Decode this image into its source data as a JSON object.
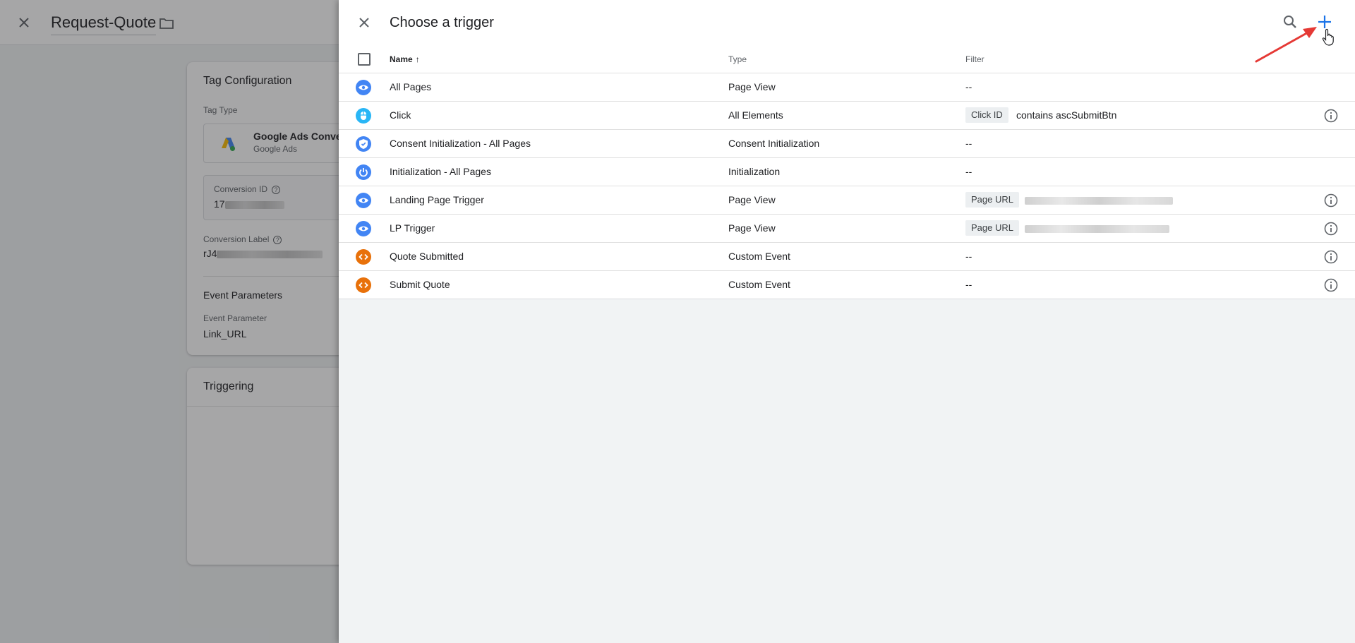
{
  "background": {
    "title": "Request-Quote",
    "tag_config": {
      "heading": "Tag Configuration",
      "tag_type_label": "Tag Type",
      "tag_type_name": "Google Ads Conver",
      "tag_type_sub": "Google Ads",
      "conversion_id_label": "Conversion ID",
      "conversion_id_prefix": "17",
      "conversion_label_label": "Conversion Label",
      "conversion_label_prefix": "rJ4",
      "event_params_heading": "Event Parameters",
      "event_param_label": "Event Parameter",
      "event_param_value": "Link_URL"
    },
    "triggering": {
      "heading": "Triggering"
    }
  },
  "drawer": {
    "title": "Choose a trigger",
    "columns": {
      "name": "Name",
      "sort_arrow": "↑",
      "type": "Type",
      "filter": "Filter"
    },
    "rows": [
      {
        "name": "All Pages",
        "type": "Page View",
        "icon": "eye-icon",
        "color": "#4285f4",
        "filter_text": "--"
      },
      {
        "name": "Click",
        "type": "All Elements",
        "icon": "mouse-icon",
        "color": "#29b6f6",
        "filter_chip": "Click ID",
        "filter_text": "contains ascSubmitBtn",
        "info": true
      },
      {
        "name": "Consent Initialization - All Pages",
        "type": "Consent Initialization",
        "icon": "shield-icon",
        "color": "#4285f4",
        "filter_text": "--"
      },
      {
        "name": "Initialization - All Pages",
        "type": "Initialization",
        "icon": "power-icon",
        "color": "#4285f4",
        "filter_text": "--"
      },
      {
        "name": "Landing Page Trigger",
        "type": "Page View",
        "icon": "eye-icon",
        "color": "#4285f4",
        "filter_chip": "Page URL",
        "filter_blurred": true,
        "info": true
      },
      {
        "name": "LP Trigger",
        "type": "Page View",
        "icon": "eye-icon",
        "color": "#4285f4",
        "filter_chip": "Page URL",
        "filter_blurred": true,
        "info": true
      },
      {
        "name": "Quote Submitted",
        "type": "Custom Event",
        "icon": "code-icon",
        "color": "#e8710a",
        "filter_text": "--",
        "info": true
      },
      {
        "name": "Submit Quote",
        "type": "Custom Event",
        "icon": "code-icon",
        "color": "#e8710a",
        "filter_text": "--",
        "info": true
      }
    ]
  },
  "colors": {
    "accent": "#1a73e8",
    "annotation_arrow": "#e53935"
  }
}
